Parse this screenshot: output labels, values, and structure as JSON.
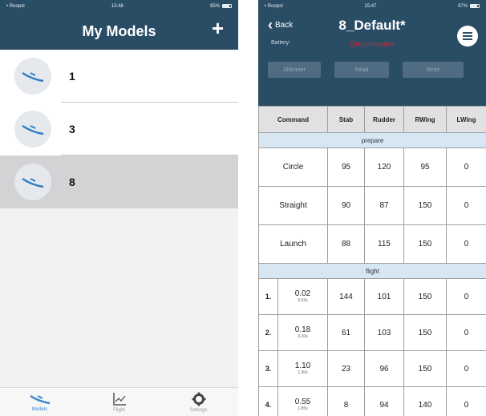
{
  "left": {
    "status": {
      "carrier": "• Roopst",
      "time": "15:48",
      "battery": "95%"
    },
    "title": "My Models",
    "add_label": "+",
    "models": [
      {
        "name": "1",
        "selected": false
      },
      {
        "name": "3",
        "selected": false
      },
      {
        "name": "8",
        "selected": true
      }
    ],
    "tabs": [
      {
        "label": "Models",
        "icon": "model-plane-icon",
        "active": true
      },
      {
        "label": "Flight",
        "icon": "chart-icon",
        "active": false
      },
      {
        "label": "Settings",
        "icon": "gear-icon",
        "active": false
      }
    ]
  },
  "right": {
    "status": {
      "carrier": "• Roopst",
      "time": "15:47",
      "battery": "97%"
    },
    "back_label": "Back",
    "title": "8_Default*",
    "battery_label": "Battery:",
    "battery_status": "Disconnected",
    "buttons": {
      "altimeter": "Altimeter",
      "read": "Read",
      "write": "Write"
    },
    "columns": [
      "Command",
      "Stab",
      "Rudder",
      "RWing",
      "LWing"
    ],
    "sections": {
      "prepare": {
        "title": "prepare",
        "rows": [
          {
            "command": "Circle",
            "stab": "95",
            "rudder": "120",
            "rwing": "95",
            "lwing": "0"
          },
          {
            "command": "Straight",
            "stab": "90",
            "rudder": "87",
            "rwing": "150",
            "lwing": "0"
          },
          {
            "command": "Launch",
            "stab": "88",
            "rudder": "115",
            "rwing": "150",
            "lwing": "0"
          }
        ]
      },
      "flight": {
        "title": "flight",
        "rows": [
          {
            "index": "1.",
            "time": "0.02",
            "time_sub": "0.02s",
            "stab": "144",
            "rudder": "101",
            "rwing": "150",
            "lwing": "0"
          },
          {
            "index": "2.",
            "time": "0.18",
            "time_sub": "0.20s",
            "stab": "61",
            "rudder": "103",
            "rwing": "150",
            "lwing": "0"
          },
          {
            "index": "3.",
            "time": "1.10",
            "time_sub": "1.30s",
            "stab": "23",
            "rudder": "96",
            "rwing": "150",
            "lwing": "0"
          },
          {
            "index": "4.",
            "time": "0.55",
            "time_sub": "1.85s",
            "stab": "8",
            "rudder": "94",
            "rwing": "140",
            "lwing": "0"
          }
        ]
      }
    },
    "colors": {
      "header": "#2a4d66",
      "section": "#d6e6f3",
      "alert": "#e0202a",
      "tab_active": "#3a86c8"
    }
  }
}
